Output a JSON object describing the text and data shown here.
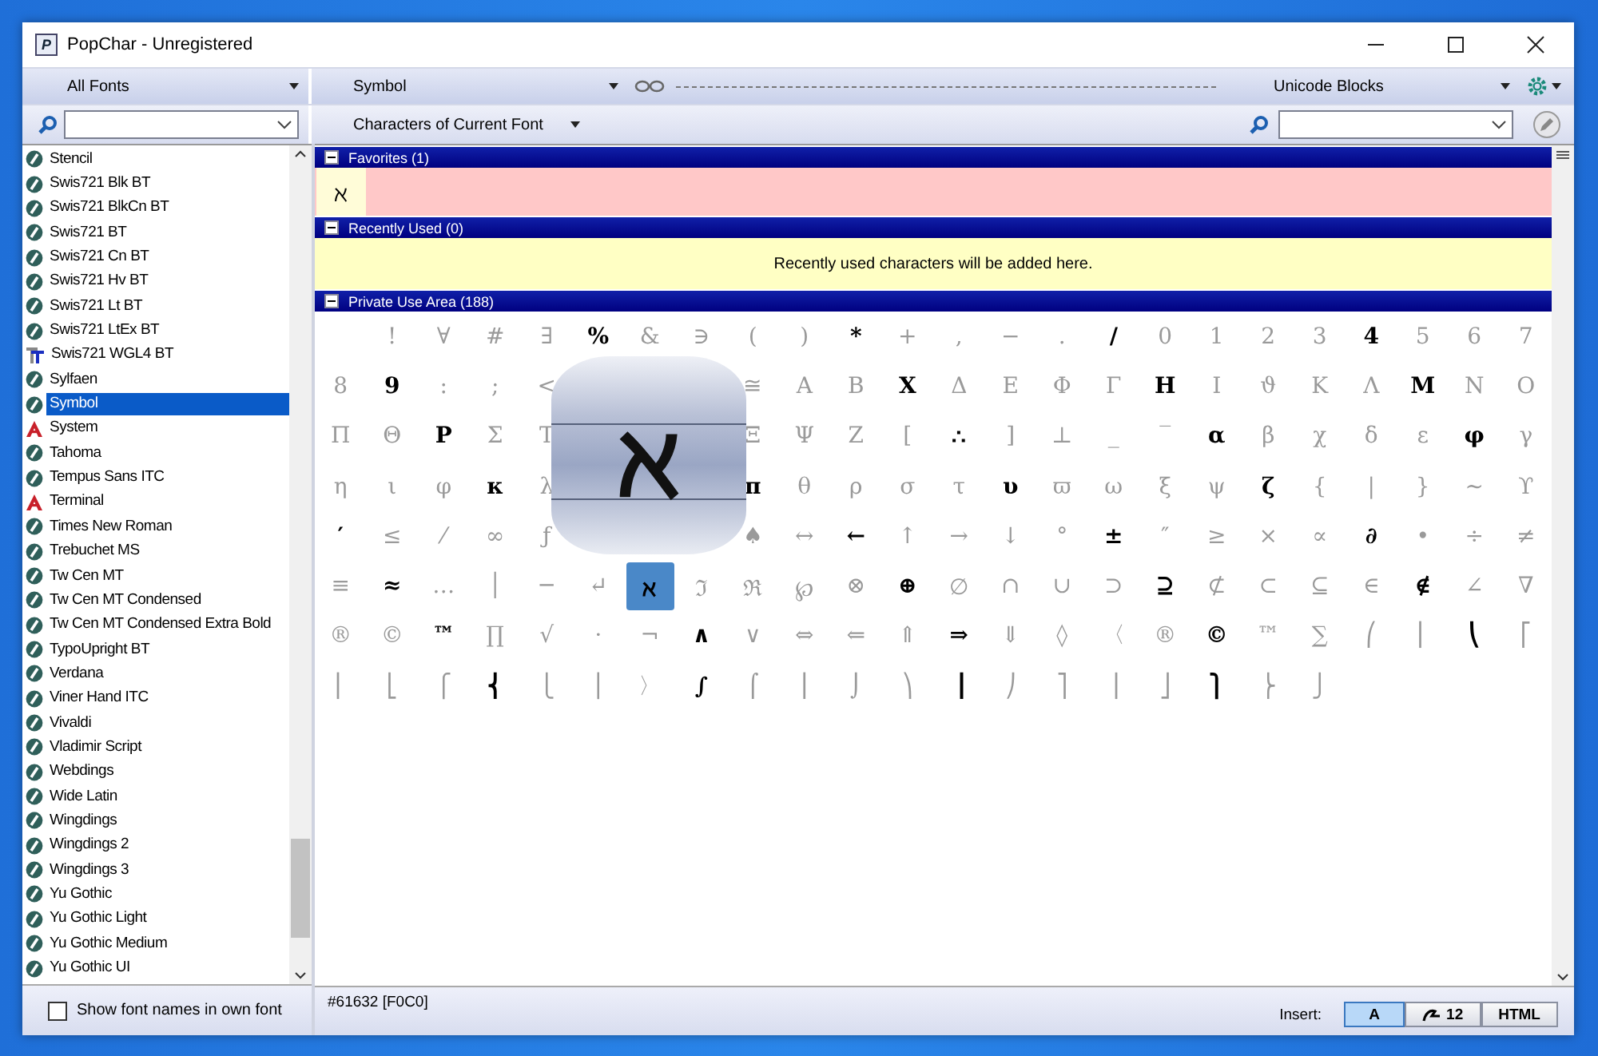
{
  "window": {
    "title": "PopChar - Unregistered",
    "app_icon_letter": "P"
  },
  "toolbar": {
    "font_filter": "All Fonts",
    "current_font": "Symbol",
    "block_view": "Unicode Blocks",
    "char_filter": "Characters of Current Font"
  },
  "font_list": [
    {
      "name": "Stencil",
      "kind": "opentype",
      "selected": false
    },
    {
      "name": "Swis721 Blk BT",
      "kind": "opentype",
      "selected": false
    },
    {
      "name": "Swis721 BlkCn BT",
      "kind": "opentype",
      "selected": false
    },
    {
      "name": "Swis721 BT",
      "kind": "opentype",
      "selected": false
    },
    {
      "name": "Swis721 Cn BT",
      "kind": "opentype",
      "selected": false
    },
    {
      "name": "Swis721 Hv BT",
      "kind": "opentype",
      "selected": false
    },
    {
      "name": "Swis721 Lt BT",
      "kind": "opentype",
      "selected": false
    },
    {
      "name": "Swis721 LtEx BT",
      "kind": "opentype",
      "selected": false
    },
    {
      "name": "Swis721 WGL4 BT",
      "kind": "truetype",
      "selected": false
    },
    {
      "name": "Sylfaen",
      "kind": "opentype",
      "selected": false
    },
    {
      "name": "Symbol",
      "kind": "opentype",
      "selected": true
    },
    {
      "name": "System",
      "kind": "raster",
      "selected": false
    },
    {
      "name": "Tahoma",
      "kind": "opentype",
      "selected": false
    },
    {
      "name": "Tempus Sans ITC",
      "kind": "opentype",
      "selected": false
    },
    {
      "name": "Terminal",
      "kind": "raster",
      "selected": false
    },
    {
      "name": "Times New Roman",
      "kind": "opentype",
      "selected": false
    },
    {
      "name": "Trebuchet MS",
      "kind": "opentype",
      "selected": false
    },
    {
      "name": "Tw Cen MT",
      "kind": "opentype",
      "selected": false
    },
    {
      "name": "Tw Cen MT Condensed",
      "kind": "opentype",
      "selected": false
    },
    {
      "name": "Tw Cen MT Condensed Extra Bold",
      "kind": "opentype",
      "selected": false
    },
    {
      "name": "TypoUpright BT",
      "kind": "opentype",
      "selected": false
    },
    {
      "name": "Verdana",
      "kind": "opentype",
      "selected": false
    },
    {
      "name": "Viner Hand ITC",
      "kind": "opentype",
      "selected": false
    },
    {
      "name": "Vivaldi",
      "kind": "opentype",
      "selected": false
    },
    {
      "name": "Vladimir Script",
      "kind": "opentype",
      "selected": false
    },
    {
      "name": "Webdings",
      "kind": "opentype",
      "selected": false
    },
    {
      "name": "Wide Latin",
      "kind": "opentype",
      "selected": false
    },
    {
      "name": "Wingdings",
      "kind": "opentype",
      "selected": false
    },
    {
      "name": "Wingdings 2",
      "kind": "opentype",
      "selected": false
    },
    {
      "name": "Wingdings 3",
      "kind": "opentype",
      "selected": false
    },
    {
      "name": "Yu Gothic",
      "kind": "opentype",
      "selected": false
    },
    {
      "name": "Yu Gothic Light",
      "kind": "opentype",
      "selected": false
    },
    {
      "name": "Yu Gothic Medium",
      "kind": "opentype",
      "selected": false
    },
    {
      "name": "Yu Gothic UI",
      "kind": "opentype",
      "selected": false
    }
  ],
  "show_font_names": {
    "label": "Show font names in own font",
    "checked": false
  },
  "sections": [
    {
      "title": "Favorites (1)",
      "kind": "favorites",
      "expanded": true,
      "chars": [
        "ℵ"
      ]
    },
    {
      "title": "Recently Used (0)",
      "kind": "recent",
      "expanded": true,
      "message": "Recently used characters will be added here."
    },
    {
      "title": "Private Use Area (188)",
      "kind": "grid",
      "expanded": true
    }
  ],
  "grid": [
    [
      {
        "kind": "blank"
      },
      {
        "kind": "char",
        "c": "!",
        "active": false
      },
      {
        "kind": "char",
        "c": "∀",
        "active": false
      },
      {
        "kind": "char",
        "c": "#",
        "active": false
      },
      {
        "kind": "char",
        "c": "∃",
        "active": false
      },
      {
        "kind": "char",
        "c": "%",
        "active": true
      },
      {
        "kind": "char",
        "c": "&",
        "active": false
      },
      {
        "kind": "char",
        "c": "∋",
        "active": false
      },
      {
        "kind": "char",
        "c": "(",
        "active": false
      },
      {
        "kind": "char",
        "c": ")",
        "active": false
      },
      {
        "kind": "char",
        "c": "*",
        "active": true
      },
      {
        "kind": "char",
        "c": "+",
        "active": false
      },
      {
        "kind": "char",
        "c": ",",
        "active": false
      },
      {
        "kind": "char",
        "c": "−",
        "active": false
      },
      {
        "kind": "char",
        "c": ".",
        "active": false
      },
      {
        "kind": "char",
        "c": "/",
        "active": true
      },
      {
        "kind": "char",
        "c": "0",
        "active": false
      },
      {
        "kind": "char",
        "c": "1",
        "active": false
      },
      {
        "kind": "char",
        "c": "2",
        "active": false
      },
      {
        "kind": "char",
        "c": "3",
        "active": false
      },
      {
        "kind": "char",
        "c": "4",
        "active": true
      },
      {
        "kind": "char",
        "c": "5",
        "active": false
      },
      {
        "kind": "char",
        "c": "6",
        "active": false
      },
      {
        "kind": "char",
        "c": "7",
        "active": false
      }
    ],
    [
      {
        "kind": "char",
        "c": "8",
        "active": false
      },
      {
        "kind": "char",
        "c": "9",
        "active": true
      },
      {
        "kind": "char",
        "c": ":",
        "active": false
      },
      {
        "kind": "char",
        "c": ";",
        "active": false
      },
      {
        "kind": "char",
        "c": "<",
        "active": false
      },
      {
        "kind": "blank"
      },
      {
        "kind": "blank"
      },
      {
        "kind": "blank"
      },
      {
        "kind": "char",
        "c": "≅",
        "active": false
      },
      {
        "kind": "char",
        "c": "Α",
        "active": false
      },
      {
        "kind": "char",
        "c": "Β",
        "active": false
      },
      {
        "kind": "char",
        "c": "Χ",
        "active": true
      },
      {
        "kind": "char",
        "c": "Δ",
        "active": false
      },
      {
        "kind": "char",
        "c": "Ε",
        "active": false
      },
      {
        "kind": "char",
        "c": "Φ",
        "active": false
      },
      {
        "kind": "char",
        "c": "Γ",
        "active": false
      },
      {
        "kind": "char",
        "c": "Η",
        "active": true
      },
      {
        "kind": "char",
        "c": "Ι",
        "active": false
      },
      {
        "kind": "char",
        "c": "ϑ",
        "active": false
      },
      {
        "kind": "char",
        "c": "Κ",
        "active": false
      },
      {
        "kind": "char",
        "c": "Λ",
        "active": false
      },
      {
        "kind": "char",
        "c": "Μ",
        "active": true
      },
      {
        "kind": "char",
        "c": "Ν",
        "active": false
      },
      {
        "kind": "char",
        "c": "Ο",
        "active": false
      }
    ],
    [
      {
        "kind": "char",
        "c": "Π",
        "active": false
      },
      {
        "kind": "char",
        "c": "Θ",
        "active": false
      },
      {
        "kind": "char",
        "c": "Ρ",
        "active": true
      },
      {
        "kind": "char",
        "c": "Σ",
        "active": false
      },
      {
        "kind": "char",
        "c": "Τ",
        "active": false
      },
      {
        "kind": "blank"
      },
      {
        "kind": "blank"
      },
      {
        "kind": "blank"
      },
      {
        "kind": "char",
        "c": "Ξ",
        "active": false
      },
      {
        "kind": "char",
        "c": "Ψ",
        "active": false
      },
      {
        "kind": "char",
        "c": "Ζ",
        "active": false
      },
      {
        "kind": "char",
        "c": "[",
        "active": false
      },
      {
        "kind": "char",
        "c": "∴",
        "active": true
      },
      {
        "kind": "char",
        "c": "]",
        "active": false
      },
      {
        "kind": "char",
        "c": "⊥",
        "active": false
      },
      {
        "kind": "char",
        "c": "_",
        "active": false
      },
      {
        "kind": "char",
        "c": "‾",
        "active": false
      },
      {
        "kind": "char",
        "c": "α",
        "active": true
      },
      {
        "kind": "char",
        "c": "β",
        "active": false
      },
      {
        "kind": "char",
        "c": "χ",
        "active": false
      },
      {
        "kind": "char",
        "c": "δ",
        "active": false
      },
      {
        "kind": "char",
        "c": "ε",
        "active": false
      },
      {
        "kind": "char",
        "c": "φ",
        "active": true
      },
      {
        "kind": "char",
        "c": "γ",
        "active": false
      }
    ],
    [
      {
        "kind": "char",
        "c": "η",
        "active": false
      },
      {
        "kind": "char",
        "c": "ι",
        "active": false
      },
      {
        "kind": "char",
        "c": "φ",
        "active": false
      },
      {
        "kind": "char",
        "c": "κ",
        "active": true
      },
      {
        "kind": "char",
        "c": "λ",
        "active": false
      },
      {
        "kind": "blank"
      },
      {
        "kind": "blank"
      },
      {
        "kind": "blank"
      },
      {
        "kind": "char",
        "c": "π",
        "active": true
      },
      {
        "kind": "char",
        "c": "θ",
        "active": false
      },
      {
        "kind": "char",
        "c": "ρ",
        "active": false
      },
      {
        "kind": "char",
        "c": "σ",
        "active": false
      },
      {
        "kind": "char",
        "c": "τ",
        "active": false
      },
      {
        "kind": "char",
        "c": "υ",
        "active": true
      },
      {
        "kind": "char",
        "c": "ϖ",
        "active": false
      },
      {
        "kind": "char",
        "c": "ω",
        "active": false
      },
      {
        "kind": "char",
        "c": "ξ",
        "active": false
      },
      {
        "kind": "char",
        "c": "ψ",
        "active": false
      },
      {
        "kind": "char",
        "c": "ζ",
        "active": true
      },
      {
        "kind": "char",
        "c": "{",
        "active": false
      },
      {
        "kind": "char",
        "c": "|",
        "active": false
      },
      {
        "kind": "char",
        "c": "}",
        "active": false
      },
      {
        "kind": "char",
        "c": "~",
        "active": false
      },
      {
        "kind": "char",
        "c": "ϒ",
        "active": false
      }
    ],
    [
      {
        "kind": "char",
        "c": "′",
        "active": true
      },
      {
        "kind": "char",
        "c": "≤",
        "active": false
      },
      {
        "kind": "char",
        "c": "⁄",
        "active": false
      },
      {
        "kind": "char",
        "c": "∞",
        "active": false
      },
      {
        "kind": "char",
        "c": "ƒ",
        "active": false
      },
      {
        "kind": "blank"
      },
      {
        "kind": "blank"
      },
      {
        "kind": "blank"
      },
      {
        "kind": "char",
        "c": "♠",
        "active": false
      },
      {
        "kind": "char",
        "c": "↔",
        "active": false
      },
      {
        "kind": "char",
        "c": "←",
        "active": true
      },
      {
        "kind": "char",
        "c": "↑",
        "active": false
      },
      {
        "kind": "char",
        "c": "→",
        "active": false
      },
      {
        "kind": "char",
        "c": "↓",
        "active": false
      },
      {
        "kind": "char",
        "c": "°",
        "active": false
      },
      {
        "kind": "char",
        "c": "±",
        "active": true
      },
      {
        "kind": "char",
        "c": "″",
        "active": false
      },
      {
        "kind": "char",
        "c": "≥",
        "active": false
      },
      {
        "kind": "char",
        "c": "×",
        "active": false
      },
      {
        "kind": "char",
        "c": "∝",
        "active": false
      },
      {
        "kind": "char",
        "c": "∂",
        "active": true
      },
      {
        "kind": "char",
        "c": "•",
        "active": false
      },
      {
        "kind": "char",
        "c": "÷",
        "active": false
      },
      {
        "kind": "char",
        "c": "≠",
        "active": false
      }
    ],
    [
      {
        "kind": "char",
        "c": "≡",
        "active": false
      },
      {
        "kind": "char",
        "c": "≈",
        "active": true
      },
      {
        "kind": "char",
        "c": "…",
        "active": false
      },
      {
        "kind": "char",
        "c": "│",
        "active": false
      },
      {
        "kind": "char",
        "c": "─",
        "active": false
      },
      {
        "kind": "char",
        "c": "↵",
        "active": false
      },
      {
        "kind": "char",
        "c": "ℵ",
        "active": true,
        "selected": true
      },
      {
        "kind": "char",
        "c": "ℑ",
        "active": false
      },
      {
        "kind": "char",
        "c": "ℜ",
        "active": false
      },
      {
        "kind": "char",
        "c": "℘",
        "active": false
      },
      {
        "kind": "char",
        "c": "⊗",
        "active": false
      },
      {
        "kind": "char",
        "c": "⊕",
        "active": true
      },
      {
        "kind": "char",
        "c": "∅",
        "active": false
      },
      {
        "kind": "char",
        "c": "∩",
        "active": false
      },
      {
        "kind": "char",
        "c": "∪",
        "active": false
      },
      {
        "kind": "char",
        "c": "⊃",
        "active": false
      },
      {
        "kind": "char",
        "c": "⊇",
        "active": true
      },
      {
        "kind": "char",
        "c": "⊄",
        "active": false
      },
      {
        "kind": "char",
        "c": "⊂",
        "active": false
      },
      {
        "kind": "char",
        "c": "⊆",
        "active": false
      },
      {
        "kind": "char",
        "c": "∈",
        "active": false
      },
      {
        "kind": "char",
        "c": "∉",
        "active": true
      },
      {
        "kind": "char",
        "c": "∠",
        "active": false
      },
      {
        "kind": "char",
        "c": "∇",
        "active": false
      }
    ],
    [
      {
        "kind": "char",
        "c": "®",
        "active": false
      },
      {
        "kind": "char",
        "c": "©",
        "active": false
      },
      {
        "kind": "char",
        "c": "™",
        "active": true
      },
      {
        "kind": "char",
        "c": "∏",
        "active": false
      },
      {
        "kind": "char",
        "c": "√",
        "active": false
      },
      {
        "kind": "char",
        "c": "⋅",
        "active": false
      },
      {
        "kind": "char",
        "c": "¬",
        "active": false
      },
      {
        "kind": "char",
        "c": "∧",
        "active": true
      },
      {
        "kind": "char",
        "c": "∨",
        "active": false
      },
      {
        "kind": "char",
        "c": "⇔",
        "active": false
      },
      {
        "kind": "char",
        "c": "⇐",
        "active": false
      },
      {
        "kind": "char",
        "c": "⇑",
        "active": false
      },
      {
        "kind": "char",
        "c": "⇒",
        "active": true
      },
      {
        "kind": "char",
        "c": "⇓",
        "active": false
      },
      {
        "kind": "char",
        "c": "◊",
        "active": false
      },
      {
        "kind": "char",
        "c": "〈",
        "active": false
      },
      {
        "kind": "char",
        "c": "®",
        "active": false
      },
      {
        "kind": "char",
        "c": "©",
        "active": true
      },
      {
        "kind": "char",
        "c": "™",
        "active": false
      },
      {
        "kind": "char",
        "c": "∑",
        "active": false
      },
      {
        "kind": "char",
        "c": "⎛",
        "active": false
      },
      {
        "kind": "char",
        "c": "⎜",
        "active": false
      },
      {
        "kind": "char",
        "c": "⎝",
        "active": true
      },
      {
        "kind": "char",
        "c": "⎡",
        "active": false
      }
    ],
    [
      {
        "kind": "char",
        "c": "⎢",
        "active": false
      },
      {
        "kind": "char",
        "c": "⎣",
        "active": false
      },
      {
        "kind": "char",
        "c": "⎧",
        "active": false
      },
      {
        "kind": "char",
        "c": "⎨",
        "active": true
      },
      {
        "kind": "char",
        "c": "⎩",
        "active": false
      },
      {
        "kind": "char",
        "c": "⎪",
        "active": false
      },
      {
        "kind": "char",
        "c": "〉",
        "active": false
      },
      {
        "kind": "char",
        "c": "∫",
        "active": true
      },
      {
        "kind": "char",
        "c": "⌠",
        "active": false
      },
      {
        "kind": "char",
        "c": "⎮",
        "active": false
      },
      {
        "kind": "char",
        "c": "⌡",
        "active": false
      },
      {
        "kind": "char",
        "c": "⎞",
        "active": false
      },
      {
        "kind": "char",
        "c": "⎟",
        "active": true
      },
      {
        "kind": "char",
        "c": "⎠",
        "active": false
      },
      {
        "kind": "char",
        "c": "⎤",
        "active": false
      },
      {
        "kind": "char",
        "c": "⎥",
        "active": false
      },
      {
        "kind": "char",
        "c": "⎦",
        "active": false
      },
      {
        "kind": "char",
        "c": "⎫",
        "active": true
      },
      {
        "kind": "char",
        "c": "⎬",
        "active": false
      },
      {
        "kind": "char",
        "c": "⎭",
        "active": false
      }
    ]
  ],
  "magnifier": {
    "char": "ℵ"
  },
  "status": {
    "code": "#61632 [F0C0]",
    "insert_label": "Insert:",
    "insert_modes": [
      {
        "label": "A",
        "kind": "char",
        "selected": true
      },
      {
        "label": "12",
        "kind": "code",
        "selected": false
      },
      {
        "label": "HTML",
        "kind": "html",
        "selected": false
      }
    ]
  }
}
